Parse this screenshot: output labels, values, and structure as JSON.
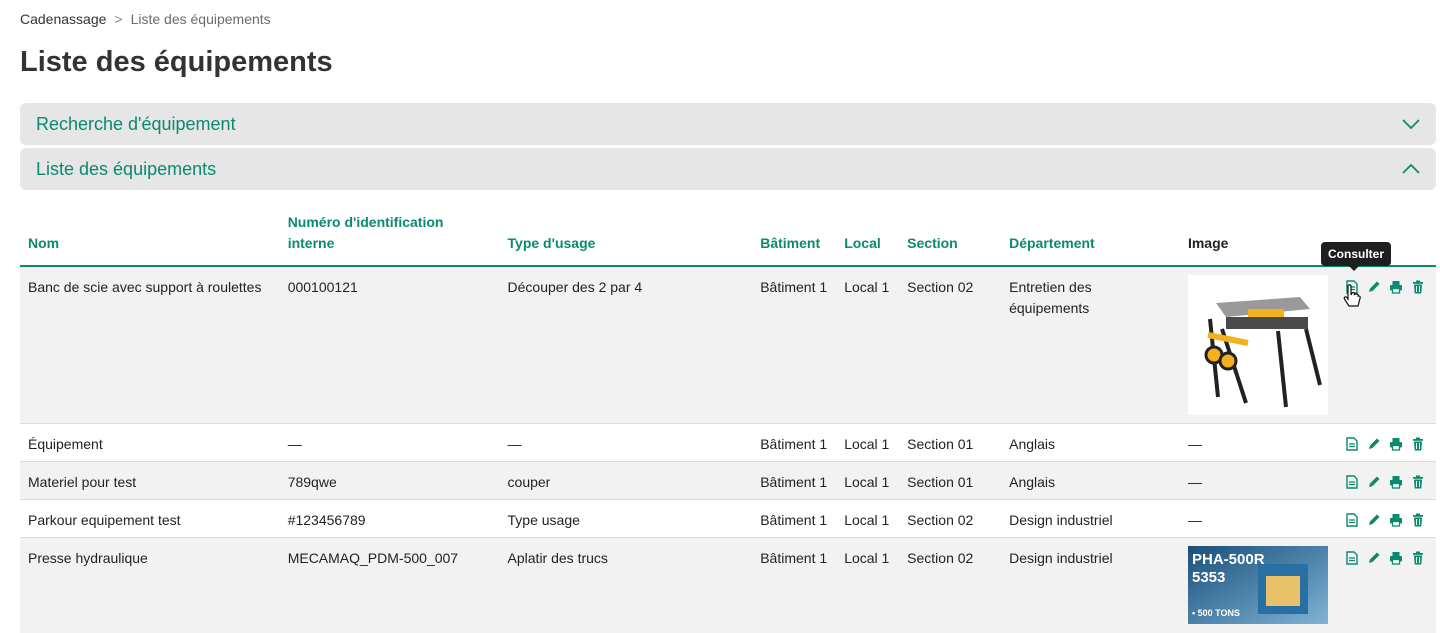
{
  "breadcrumb": {
    "root": "Cadenassage",
    "separator": ">",
    "current": "Liste des équipements"
  },
  "page_title": "Liste des équipements",
  "panels": {
    "search": {
      "label": "Recherche d'équipement",
      "state": "collapsed"
    },
    "list": {
      "label": "Liste des équipements",
      "state": "expanded"
    }
  },
  "table": {
    "headers": {
      "nom": "Nom",
      "numero": "Numéro d'identification interne",
      "type": "Type d'usage",
      "batiment": "Bâtiment",
      "local": "Local",
      "section": "Section",
      "departement": "Département",
      "image": "Image"
    },
    "rows": [
      {
        "nom": "Banc de scie avec support à roulettes",
        "numero": "000100121",
        "type": "Découper des 2 par 4",
        "batiment": "Bâtiment 1",
        "local": "Local 1",
        "section": "Section 02",
        "departement": "Entretien des équipements",
        "image": "table-saw-photo"
      },
      {
        "nom": "Équipement",
        "numero": "—",
        "type": "—",
        "batiment": "Bâtiment 1",
        "local": "Local 1",
        "section": "Section 01",
        "departement": "Anglais",
        "image": "—"
      },
      {
        "nom": "Materiel pour test",
        "numero": "789qwe",
        "type": "couper",
        "batiment": "Bâtiment 1",
        "local": "Local 1",
        "section": "Section 01",
        "departement": "Anglais",
        "image": "—"
      },
      {
        "nom": "Parkour equipement test",
        "numero": "#123456789",
        "type": "Type usage",
        "batiment": "Bâtiment 1",
        "local": "Local 1",
        "section": "Section 02",
        "departement": "Design industriel",
        "image": "—"
      },
      {
        "nom": "Presse hydraulique",
        "numero": "MECAMAQ_PDM-500_007",
        "type": "Aplatir des trucs",
        "batiment": "Bâtiment 1",
        "local": "Local 1",
        "section": "Section 02",
        "departement": "Design industriel",
        "image": "hydraulic-press-photo"
      }
    ],
    "press_image_text": {
      "model": "PHA-500R",
      "number": "5353",
      "tons": "• 500 TONS"
    }
  },
  "actions": {
    "icons": [
      "document-icon",
      "pencil-icon",
      "printer-icon",
      "trash-icon"
    ]
  },
  "tooltip": "Consulter",
  "colors": {
    "accent": "#0a8a6e",
    "panel_bg": "#e6e6e6",
    "row_shade": "#f2f2f2"
  }
}
